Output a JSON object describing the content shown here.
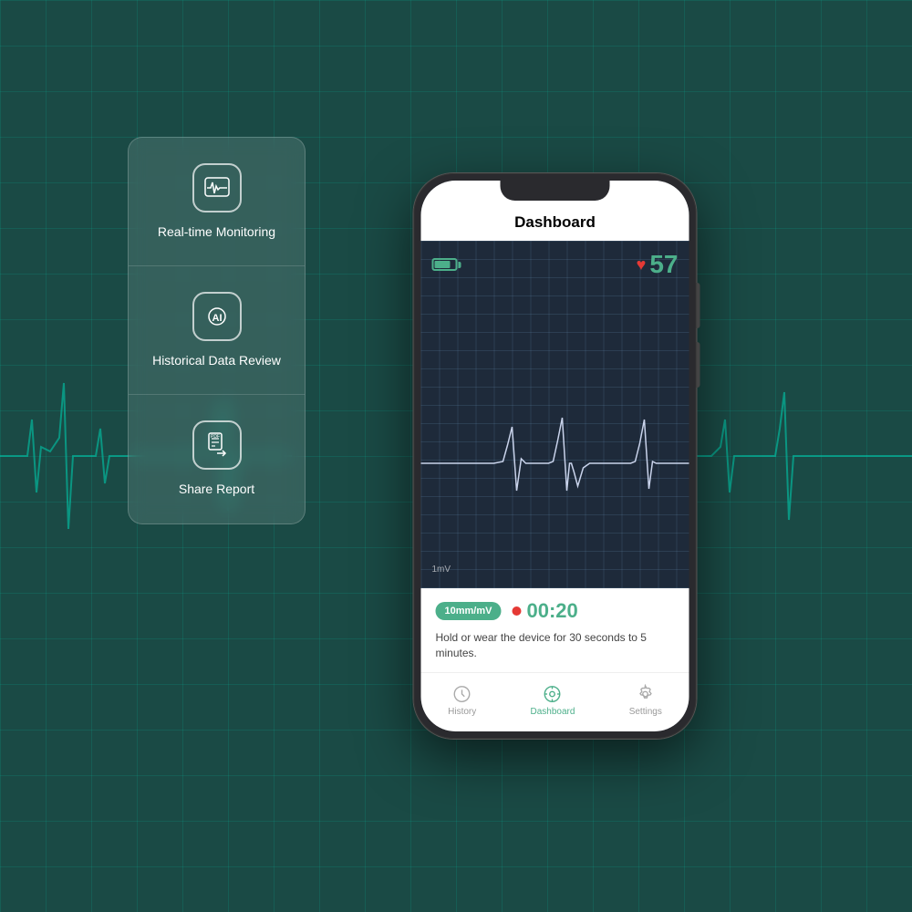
{
  "app": {
    "title": "Dashboard",
    "background_color": "#1a4a45"
  },
  "feature_panel": {
    "items": [
      {
        "id": "realtime",
        "label": "Real-time\nMonitoring",
        "icon": "heartbeat-monitor-icon"
      },
      {
        "id": "historical",
        "label": "Historical Data\nReview",
        "icon": "ai-brain-icon"
      },
      {
        "id": "share",
        "label": "Share Report",
        "icon": "pdf-share-icon"
      }
    ]
  },
  "phone": {
    "screen": {
      "header_title": "Dashboard",
      "battery_level": "70",
      "heart_rate": "57",
      "ecg_label": "1mV",
      "mm_badge": "10mm/mV",
      "timer": "00:20",
      "instruction": "Hold or wear the device for 30 seconds to 5 minutes.",
      "nav": [
        {
          "id": "history",
          "label": "History",
          "active": false
        },
        {
          "id": "dashboard",
          "label": "Dashboard",
          "active": true
        },
        {
          "id": "settings",
          "label": "Settings",
          "active": false
        }
      ]
    }
  }
}
